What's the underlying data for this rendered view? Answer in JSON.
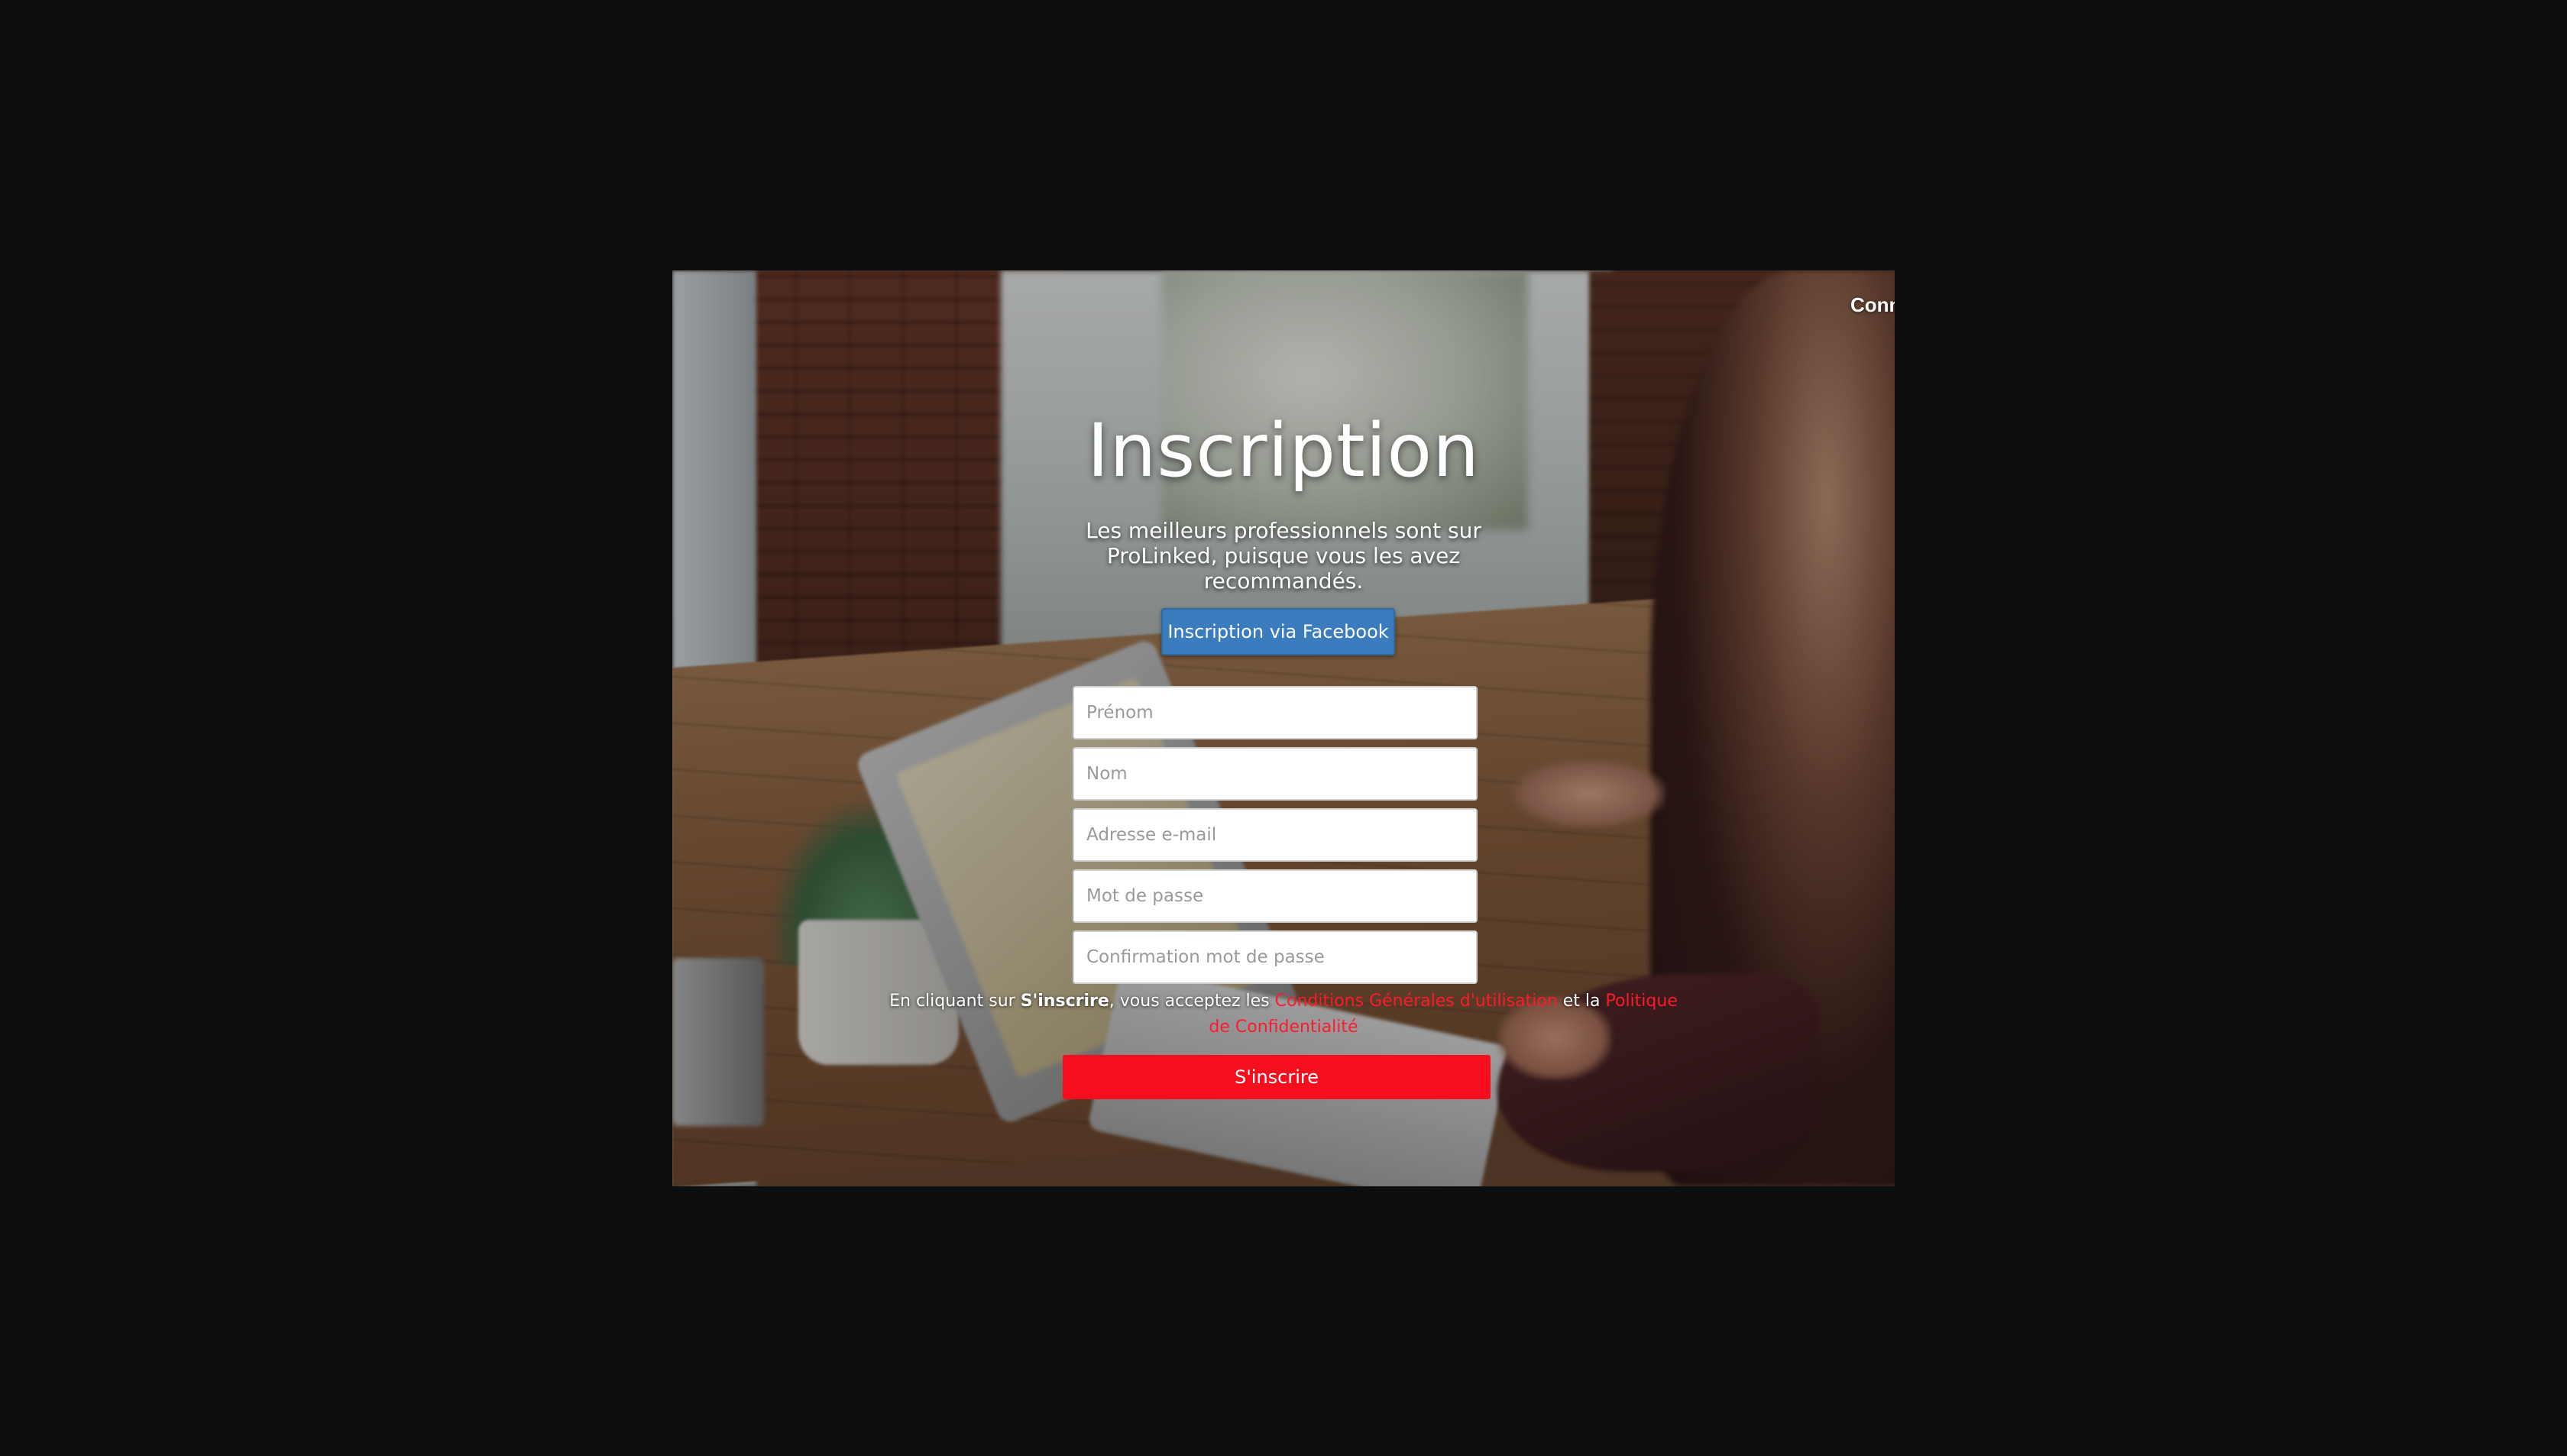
{
  "nav": {
    "top_right_link": "Conn"
  },
  "signup": {
    "title": "Inscription",
    "subtitle": "Les meilleurs professionnels sont sur ProLinked, puisque vous les avez recommandés.",
    "facebook_button": "Inscription via Facebook",
    "fields": {
      "first_name_placeholder": "Prénom",
      "last_name_placeholder": "Nom",
      "email_placeholder": "Adresse e-mail",
      "password_placeholder": "Mot de passe",
      "password_confirm_placeholder": "Confirmation mot de passe"
    },
    "terms": {
      "prefix": "En cliquant sur ",
      "action_word": "S'inscrire",
      "middle": ", vous acceptez les ",
      "cgu_link": "Conditions Générales d'utilisation",
      "and": " et la ",
      "privacy_link": "Politique de Confidentialité"
    },
    "submit_button": "S'inscrire"
  },
  "colors": {
    "page_background": "#0d0e10",
    "facebook_blue": "#3a7cbd",
    "accent_red": "#f50f1e",
    "link_red": "#ff1a2b"
  }
}
